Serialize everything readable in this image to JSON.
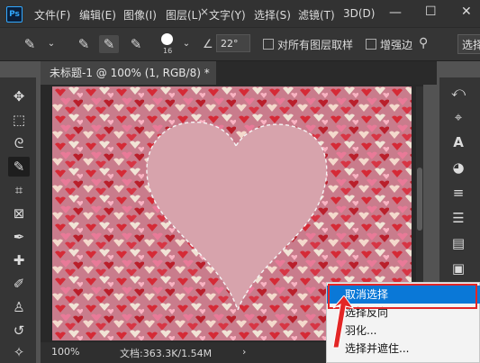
{
  "app": {
    "logo": "Ps"
  },
  "menu": [
    "文件(F)",
    "编辑(E)",
    "图像(I)",
    "图层(L)",
    "文字(Y)",
    "选择(S)",
    "滤镜(T)",
    "3D(D)"
  ],
  "options": {
    "brush_size": "16",
    "angle": "22°",
    "sample_all_layers": "对所有图层取样",
    "enhance_edge": "增强边",
    "select_subject": "选择"
  },
  "document": {
    "tab_title": "未标题-1 @ 100% (1, RGB/8) *",
    "close": "×",
    "zoom": "100%",
    "doc_info": "文档:363.3K/1.54M",
    "status_arrow": "›"
  },
  "context_menu": {
    "items": [
      "取消选择",
      "选择反向",
      "羽化...",
      "选择并遮住..."
    ],
    "highlighted_index": 0
  },
  "icons": {
    "tools": [
      "move-icon",
      "marquee-icon",
      "lasso-icon",
      "quick-selection-icon",
      "crop-icon",
      "frame-icon",
      "eyedropper-icon",
      "healing-icon",
      "brush-icon",
      "stamp-icon",
      "history-brush-icon",
      "eraser-icon"
    ],
    "right": [
      "history-icon",
      "paths-icon",
      "character-icon",
      "color-palette-icon",
      "brushes-icon",
      "adjustments-icon",
      "gradient-icon",
      "libraries-icon"
    ]
  },
  "colors": {
    "highlight": "#0a78d7",
    "annotation": "#e32626",
    "background_pink": "#c77a8a"
  }
}
